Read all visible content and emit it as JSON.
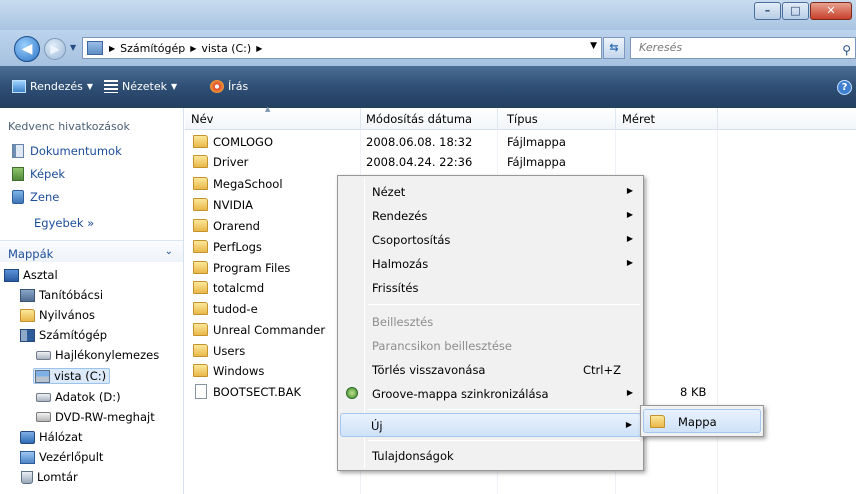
{
  "window": {
    "minimize": "–",
    "maximize": "□",
    "close": "✕"
  },
  "address": {
    "segments": [
      "Számítógép",
      "vista (C:)"
    ],
    "search_placeholder": "Keresés"
  },
  "toolbar": {
    "organize": "Rendezés",
    "views": "Nézetek",
    "burn": "Írás"
  },
  "nav": {
    "favorites_title": "Kedvenc hivatkozások",
    "favorites": [
      "Dokumentumok",
      "Képek",
      "Zene"
    ],
    "more": "Egyebek  »",
    "folders_title": "Mappák",
    "tree": [
      "Asztal",
      "Tanítóbácsi",
      "Nyilvános",
      "Számítógép",
      "Hajlékonylemezes",
      "vista (C:)",
      "Adatok (D:)",
      "DVD-RW-meghajt",
      "Hálózat",
      "Vezérlőpult",
      "Lomtár"
    ]
  },
  "columns": [
    "Név",
    "Módosítás dátuma",
    "Típus",
    "Méret"
  ],
  "files": [
    {
      "name": "COMLOGO",
      "date": "2008.06.08. 18:32",
      "type": "Fájlmappa",
      "size": ""
    },
    {
      "name": "Driver",
      "date": "2008.04.24. 22:36",
      "type": "Fájlmappa",
      "size": ""
    },
    {
      "name": "MegaSchool",
      "date": "",
      "type": "",
      "size": ""
    },
    {
      "name": "NVIDIA",
      "date": "",
      "type": "",
      "size": ""
    },
    {
      "name": "Orarend",
      "date": "",
      "type": "",
      "size": ""
    },
    {
      "name": "PerfLogs",
      "date": "",
      "type": "",
      "size": ""
    },
    {
      "name": "Program Files",
      "date": "",
      "type": "",
      "size": ""
    },
    {
      "name": "totalcmd",
      "date": "",
      "type": "",
      "size": ""
    },
    {
      "name": "tudod-e",
      "date": "",
      "type": "",
      "size": ""
    },
    {
      "name": "Unreal Commander",
      "date": "",
      "type": "",
      "size": ""
    },
    {
      "name": "Users",
      "date": "",
      "type": "",
      "size": ""
    },
    {
      "name": "Windows",
      "date": "",
      "type": "",
      "size": ""
    },
    {
      "name": "BOOTSECT.BAK",
      "date": "",
      "type": "",
      "size": "8 KB"
    }
  ],
  "context_menu": {
    "view": "Nézet",
    "sort": "Rendezés",
    "group": "Csoportosítás",
    "stack": "Halmozás",
    "refresh": "Frissítés",
    "paste": "Beillesztés",
    "paste_shortcut": "Parancsikon beillesztése",
    "undo_delete": "Törlés visszavonása",
    "undo_shortcut": "Ctrl+Z",
    "groove": "Groove-mappa szinkronizálása",
    "new": "Új",
    "properties": "Tulajdonságok"
  },
  "submenu": {
    "folder": "Mappa"
  }
}
